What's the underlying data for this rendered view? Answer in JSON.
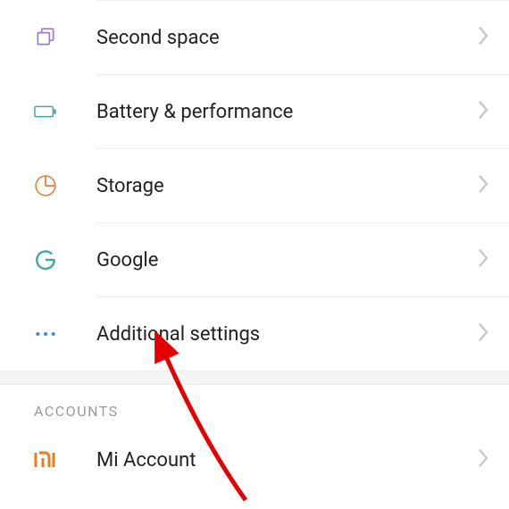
{
  "items": [
    {
      "label": "Second space",
      "icon": "second-space-icon"
    },
    {
      "label": "Battery & performance",
      "icon": "battery-icon"
    },
    {
      "label": "Storage",
      "icon": "storage-icon"
    },
    {
      "label": "Google",
      "icon": "google-icon"
    },
    {
      "label": "Additional settings",
      "icon": "more-icon"
    }
  ],
  "section_header": "ACCOUNTS",
  "accounts": [
    {
      "label": "Mi Account",
      "icon": "mi-icon"
    }
  ]
}
